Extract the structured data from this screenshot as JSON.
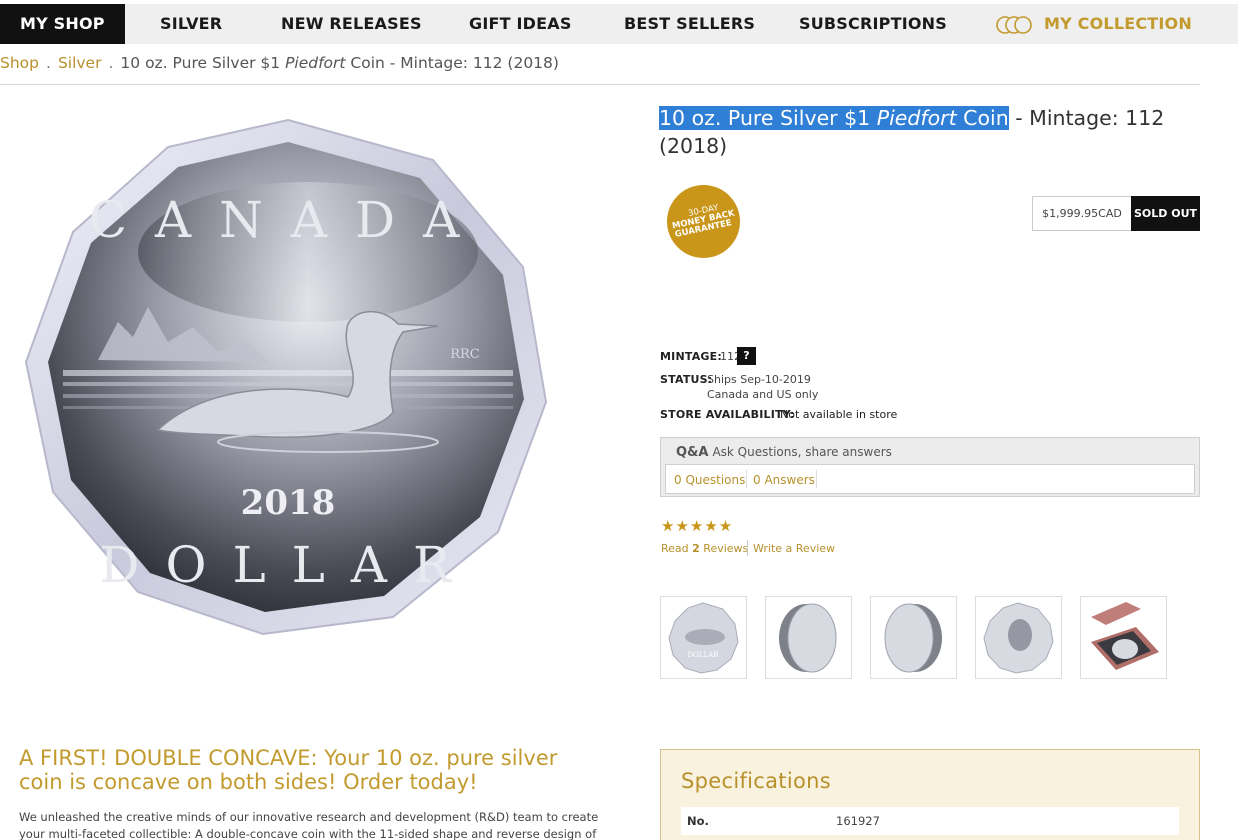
{
  "nav": {
    "items": [
      "MY SHOP",
      "SILVER",
      "NEW RELEASES",
      "GIFT IDEAS",
      "BEST SELLERS",
      "SUBSCRIPTIONS"
    ],
    "collection": "MY COLLECTION"
  },
  "breadcrumb": {
    "shop": "Shop",
    "silver": "Silver",
    "separator": ".",
    "current_a": "10 oz. Pure Silver $1 ",
    "current_italic": "Piedfort",
    "current_b": " Coin - Mintage: 112 (2018)"
  },
  "coin": {
    "top_text": "CANADA",
    "bottom_text": "DOLLAR",
    "year": "2018",
    "mark": "RRC"
  },
  "title": {
    "hl_a": "10 oz. Pure Silver $1 ",
    "hl_italic": "Piedfort",
    "hl_b": " Coin",
    "rest": " - Mintage: 112 (2018)"
  },
  "badge": {
    "line1": "30-DAY",
    "line2": "MONEY BACK",
    "line3": "GUARANTEE"
  },
  "price": {
    "amount": "$1,999.95CAD",
    "status": "SOLD OUT"
  },
  "details": {
    "mintage_label": "MINTAGE:",
    "mintage_value": "112",
    "help": "?",
    "status_label": "STATUS:",
    "status_line1": "Ships Sep-10-2019",
    "status_line2": "Canada and US only",
    "store_label": "STORE AVAILABILITY:",
    "store_value": "Not available in store"
  },
  "qa": {
    "tag": "Q&A",
    "subtitle": "Ask Questions, share answers",
    "questions": "0 Questions",
    "answers": "0 Answers"
  },
  "reviews": {
    "stars": "★★★★★",
    "rating": 5,
    "read_a": "Read ",
    "read_count": "2",
    "read_b": " Reviews",
    "write": "Write a Review"
  },
  "thumbnails": [
    "coin-reverse",
    "coin-edge-left",
    "coin-edge-right",
    "coin-obverse",
    "coin-in-case"
  ],
  "promo": {
    "heading": "A FIRST! DOUBLE CONCAVE: Your 10 oz. pure silver coin is concave on both sides! Order today!",
    "body": "We unleashed the creative minds of our innovative research and development (R&D) team to create your multi-faceted collectible: A double-concave coin with the 11-sided shape and reverse design of"
  },
  "specs": {
    "title": "Specifications",
    "no_label": "No.",
    "no_value": "161927"
  },
  "colors": {
    "gold": "#c29a2e",
    "nav_bg": "#efefef",
    "highlight": "#2f7fd6"
  }
}
